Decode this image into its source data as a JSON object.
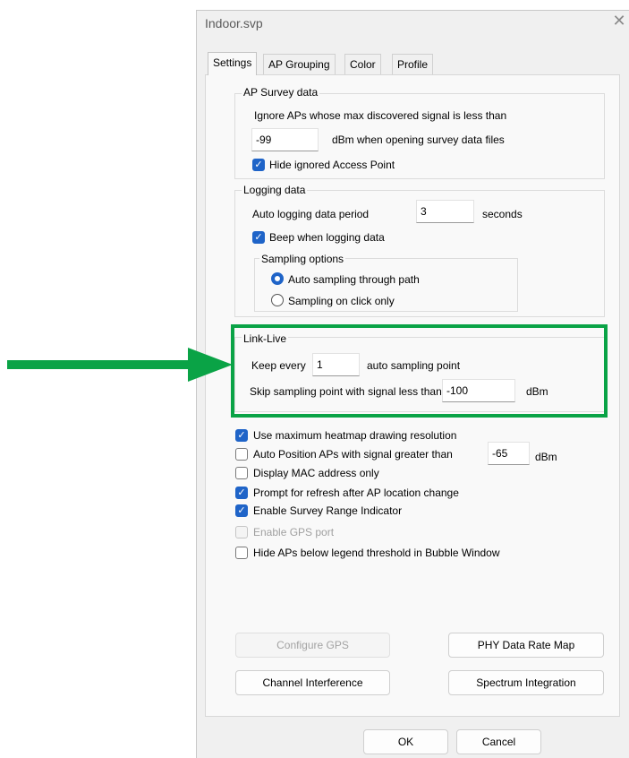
{
  "window": {
    "title": "Indoor.svp",
    "close_glyph": "✕"
  },
  "tabs": [
    {
      "label": "Settings"
    },
    {
      "label": "AP Grouping"
    },
    {
      "label": "Color"
    },
    {
      "label": "Profile"
    }
  ],
  "ap_survey": {
    "title": "AP Survey data",
    "ignore_text": "Ignore APs whose max discovered signal is less than",
    "threshold_value": "-99",
    "threshold_unit": "dBm when opening survey data files",
    "hide_ignored_label": "Hide ignored Access Point",
    "hide_ignored_checked": true
  },
  "logging": {
    "title": "Logging data",
    "period_label": "Auto logging data period",
    "period_value": "3",
    "period_unit": "seconds",
    "beep_label": "Beep when logging data",
    "beep_checked": true,
    "sampling": {
      "title": "Sampling options",
      "auto_label": "Auto sampling through path",
      "click_label": "Sampling on click only",
      "selected": "auto"
    }
  },
  "link_live": {
    "title": "Link-Live",
    "keep_prefix": "Keep every",
    "keep_value": "1",
    "keep_suffix": "auto sampling point",
    "skip_label": "Skip sampling point with signal less than",
    "skip_value": "-100",
    "skip_unit": "dBm"
  },
  "options": {
    "heatmap_label": "Use maximum heatmap drawing resolution",
    "heatmap_checked": true,
    "autopos_label": "Auto Position APs with signal greater than",
    "autopos_checked": false,
    "autopos_value": "-65",
    "autopos_unit": "dBm",
    "mac_label": "Display MAC address only",
    "mac_checked": false,
    "prompt_label": "Prompt for refresh after AP location change",
    "prompt_checked": true,
    "range_label": "Enable Survey Range Indicator",
    "range_checked": true,
    "gps_label": "Enable GPS port",
    "gps_checked": false,
    "gps_disabled": true,
    "hide_bubble_label": "Hide APs below legend threshold in Bubble Window",
    "hide_bubble_checked": false
  },
  "buttons": {
    "configure_gps": "Configure GPS",
    "phy_rate_map": "PHY Data Rate Map",
    "channel_interference": "Channel Interference",
    "spectrum_integration": "Spectrum Integration",
    "ok": "OK",
    "cancel": "Cancel"
  },
  "annotation": {
    "highlight_color": "#0aa346",
    "arrow_color": "#0aa346"
  },
  "colors": {
    "accent": "#1f64c8",
    "dialog_bg": "#f0f0f0",
    "panel_bg": "#f9f9f9"
  }
}
